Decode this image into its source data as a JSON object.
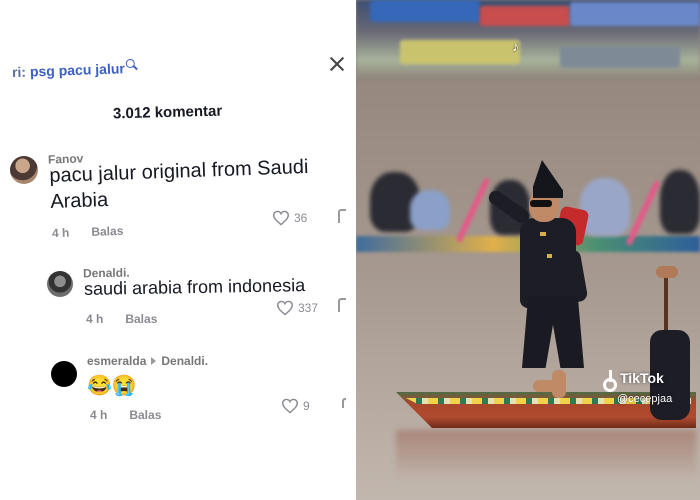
{
  "comments_panel": {
    "search_prefix": "ri:",
    "search_query": "psg pacu jalur",
    "comment_count": "3.012 komentar",
    "comments": [
      {
        "username": "Fanov",
        "line1": "pacu jalur original from Saudi",
        "line2": "Arabia",
        "time": "4 h",
        "reply_label": "Balas",
        "likes": "36"
      },
      {
        "username": "Denaldi.",
        "line1": "saudi arabia from indonesia",
        "time": "4 h",
        "reply_label": "Balas",
        "likes": "337"
      },
      {
        "username": "esmeralda",
        "reply_to": "Denaldi.",
        "line1": "😂😭",
        "time": "4 h",
        "reply_label": "Balas",
        "likes": "9"
      }
    ]
  },
  "video": {
    "watermark_brand": "TikTok",
    "watermark_user": "@cecepjaa"
  },
  "colors": {
    "search_query": "#3d5fc2",
    "muted_text": "#8a8b91",
    "primary_text": "#161823"
  },
  "icons": [
    "search-icon",
    "close-icon",
    "heart-icon",
    "tiktok-logo-icon"
  ]
}
